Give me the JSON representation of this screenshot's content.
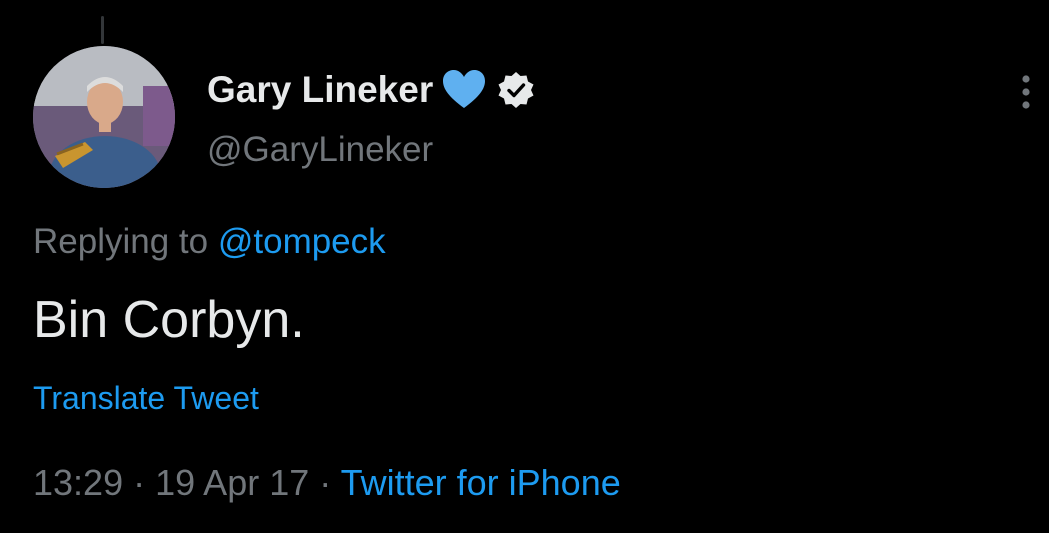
{
  "tweet": {
    "display_name": "Gary Lineker",
    "handle": "@GaryLineker",
    "reply_prefix": "Replying to",
    "reply_to": "@tompeck",
    "text": "Bin Corbyn.",
    "translate_label": "Translate Tweet",
    "time": "13:29",
    "separator": "·",
    "date": "19 Apr 17",
    "source": "Twitter for iPhone"
  },
  "icons": {
    "heart": "blue-heart-icon",
    "verified": "verified-badge-icon",
    "more": "more-options-icon"
  },
  "colors": {
    "background": "#000000",
    "primary_text": "#e7e9ea",
    "secondary_text": "#71767b",
    "accent": "#1d9bf0",
    "heart": "#5fb0f0"
  }
}
